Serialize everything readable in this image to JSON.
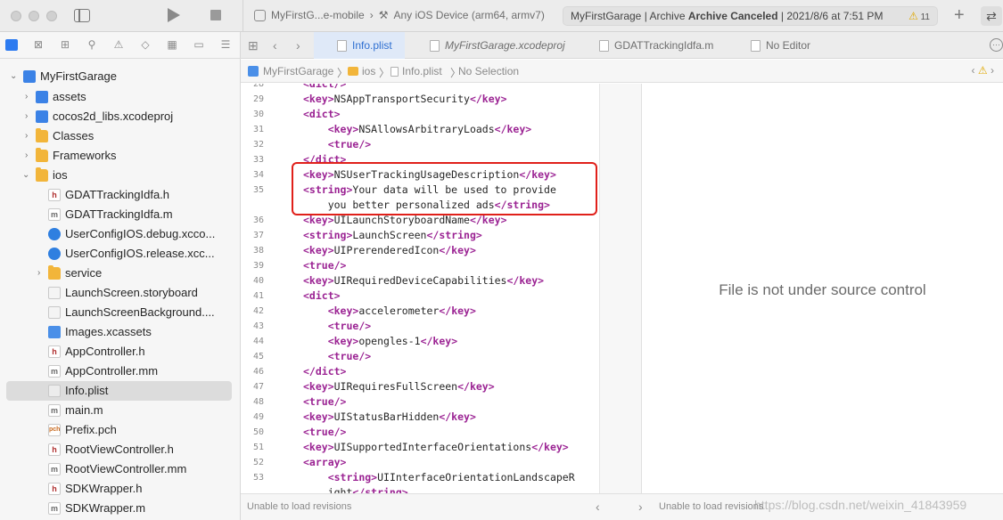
{
  "toolbar": {
    "scheme_target": "MyFirstG...e-mobile",
    "device": "Any iOS Device (arm64, armv7)",
    "activity_project": "MyFirstGarage",
    "activity_status": "Archive Canceled",
    "activity_time": "2021/8/6 at 7:51 PM",
    "warning_count": "11",
    "add_symbol": "+",
    "swap_symbol": "⇄"
  },
  "navigator": {
    "items": [
      {
        "label": "MyFirstGarage",
        "icon": "project-icon"
      },
      {
        "label": "assets",
        "icon": "blue-folder-icon"
      },
      {
        "label": "cocos2d_libs.xcodeproj",
        "icon": "project-icon"
      },
      {
        "label": "Classes",
        "icon": "folder-icon"
      },
      {
        "label": "Frameworks",
        "icon": "folder-icon"
      },
      {
        "label": "ios",
        "icon": "folder-icon"
      },
      {
        "label": "GDATTrackingIdfa.h",
        "icon": "header-file-icon",
        "badge": "h"
      },
      {
        "label": "GDATTrackingIdfa.m",
        "icon": "source-file-icon",
        "badge": "m"
      },
      {
        "label": "UserConfigIOS.debug.xcco...",
        "icon": "config-file-icon"
      },
      {
        "label": "UserConfigIOS.release.xcc...",
        "icon": "config-file-icon"
      },
      {
        "label": "service",
        "icon": "folder-icon"
      },
      {
        "label": "LaunchScreen.storyboard",
        "icon": "storyboard-icon"
      },
      {
        "label": "LaunchScreenBackground....",
        "icon": "storyboard-icon"
      },
      {
        "label": "Images.xcassets",
        "icon": "asset-catalog-icon"
      },
      {
        "label": "AppController.h",
        "icon": "header-file-icon",
        "badge": "h"
      },
      {
        "label": "AppController.mm",
        "icon": "source-file-icon",
        "badge": "m"
      },
      {
        "label": "Info.plist",
        "icon": "plist-file-icon"
      },
      {
        "label": "main.m",
        "icon": "source-file-icon",
        "badge": "m"
      },
      {
        "label": "Prefix.pch",
        "icon": "pch-file-icon",
        "badge": "pch"
      },
      {
        "label": "RootViewController.h",
        "icon": "header-file-icon",
        "badge": "h"
      },
      {
        "label": "RootViewController.mm",
        "icon": "source-file-icon",
        "badge": "m"
      },
      {
        "label": "SDKWrapper.h",
        "icon": "header-file-icon",
        "badge": "h"
      },
      {
        "label": "SDKWrapper.m",
        "icon": "source-file-icon",
        "badge": "m"
      }
    ],
    "selected": "Info.plist"
  },
  "tabs": [
    {
      "label": "Info.plist",
      "active": true
    },
    {
      "label": "MyFirstGarage.xcodeproj",
      "active": false
    },
    {
      "label": "GDATTrackingIdfa.m",
      "active": false
    },
    {
      "label": "No Editor",
      "active": false
    }
  ],
  "breadcrumb": {
    "project": "MyFirstGarage",
    "folder": "ios",
    "file": "Info.plist",
    "selection": "No Selection"
  },
  "code": {
    "lines": [
      {
        "n": "28",
        "text": "<dict/>"
      },
      {
        "n": "29",
        "text": "<key>NSAppTransportSecurity</key>"
      },
      {
        "n": "30",
        "text": "<dict>"
      },
      {
        "n": "31",
        "text": "    <key>NSAllowsArbitraryLoads</key>"
      },
      {
        "n": "32",
        "text": "    <true/>"
      },
      {
        "n": "33",
        "text": "</dict>"
      },
      {
        "n": "34",
        "text": "<key>NSUserTrackingUsageDescription</key>"
      },
      {
        "n": "35",
        "text": "<string>Your data will be used to provide"
      },
      {
        "n": "",
        "text": "    you better personalized ads</string>"
      },
      {
        "n": "36",
        "text": "<key>UILaunchStoryboardName</key>"
      },
      {
        "n": "37",
        "text": "<string>LaunchScreen</string>"
      },
      {
        "n": "38",
        "text": "<key>UIPrerenderedIcon</key>"
      },
      {
        "n": "39",
        "text": "<true/>"
      },
      {
        "n": "40",
        "text": "<key>UIRequiredDeviceCapabilities</key>"
      },
      {
        "n": "41",
        "text": "<dict>"
      },
      {
        "n": "42",
        "text": "    <key>accelerometer</key>"
      },
      {
        "n": "43",
        "text": "    <true/>"
      },
      {
        "n": "44",
        "text": "    <key>opengles-1</key>"
      },
      {
        "n": "45",
        "text": "    <true/>"
      },
      {
        "n": "46",
        "text": "</dict>"
      },
      {
        "n": "47",
        "text": "<key>UIRequiresFullScreen</key>"
      },
      {
        "n": "48",
        "text": "<true/>"
      },
      {
        "n": "49",
        "text": "<key>UIStatusBarHidden</key>"
      },
      {
        "n": "50",
        "text": "<true/>"
      },
      {
        "n": "51",
        "text": "<key>UISupportedInterfaceOrientations</key>"
      },
      {
        "n": "52",
        "text": "<array>"
      },
      {
        "n": "53",
        "text": "    <string>UIInterfaceOrientationLandscapeR"
      },
      {
        "n": "",
        "text": "    ight</string>"
      }
    ],
    "tag_color": "#9b2393",
    "highlight_color": "#e0201a"
  },
  "right_pane": {
    "message": "File is not under source control"
  },
  "bottom": {
    "left_status": "Unable to load revisions",
    "right_status": "Unable to load revisions"
  },
  "watermark": "https://blog.csdn.net/weixin_41843959"
}
